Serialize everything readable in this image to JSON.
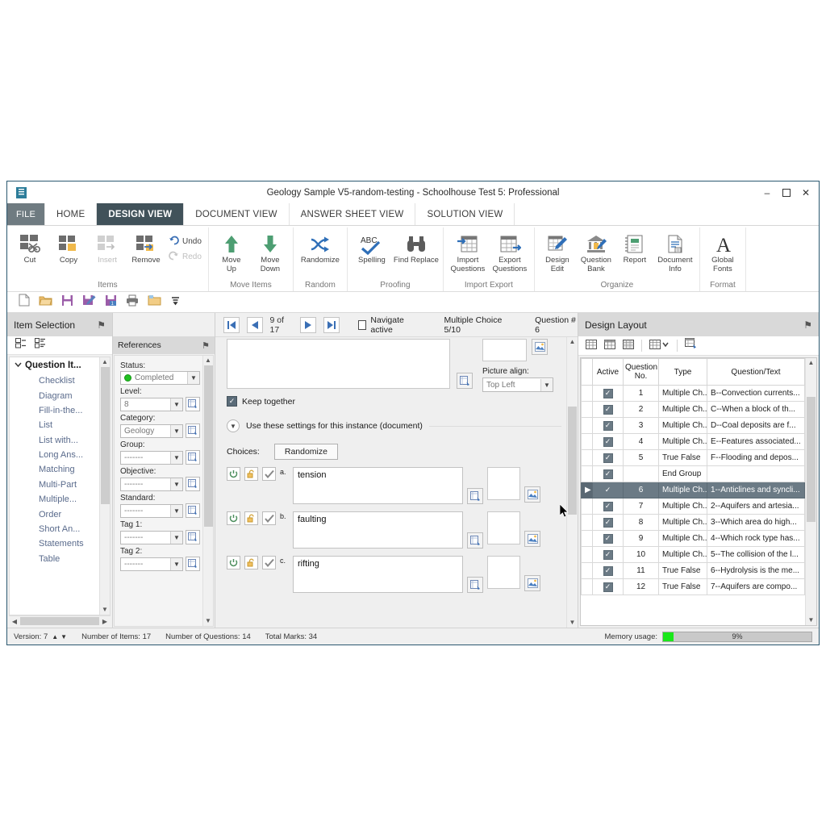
{
  "window": {
    "title": "Geology Sample V5-random-testing - Schoolhouse Test 5: Professional",
    "app_icon": "document-icon",
    "minimize": "–",
    "maximize": "❐",
    "close": "✕"
  },
  "ribbon_tabs": [
    {
      "label": "FILE",
      "style": "file"
    },
    {
      "label": "HOME",
      "style": ""
    },
    {
      "label": "DESIGN VIEW",
      "style": "active"
    },
    {
      "label": "DOCUMENT VIEW",
      "style": ""
    },
    {
      "label": "ANSWER SHEET VIEW",
      "style": ""
    },
    {
      "label": "SOLUTION VIEW",
      "style": ""
    }
  ],
  "ribbon": {
    "groups": [
      {
        "label": "Items",
        "buttons": [
          {
            "label": "Cut",
            "icon": "scissors-icon",
            "disabled": false
          },
          {
            "label": "Copy",
            "icon": "copy-icon",
            "disabled": false
          },
          {
            "label": "Insert",
            "icon": "insert-icon",
            "disabled": true
          },
          {
            "label": "Remove",
            "icon": "remove-icon",
            "disabled": false
          }
        ],
        "stack": [
          {
            "label": "Undo",
            "icon": "undo-icon",
            "disabled": false
          },
          {
            "label": "Redo",
            "icon": "redo-icon",
            "disabled": true
          }
        ]
      },
      {
        "label": "Move Items",
        "buttons": [
          {
            "label": "Move\nUp",
            "icon": "arrow-up-icon",
            "disabled": false
          },
          {
            "label": "Move\nDown",
            "icon": "arrow-down-icon",
            "disabled": false
          }
        ]
      },
      {
        "label": "Random",
        "buttons": [
          {
            "label": "Randomize",
            "icon": "shuffle-icon",
            "disabled": false
          }
        ]
      },
      {
        "label": "Proofing",
        "buttons": [
          {
            "label": "Spelling",
            "icon": "abc-check-icon",
            "disabled": false
          },
          {
            "label": "Find Replace",
            "icon": "binoculars-icon",
            "disabled": false
          }
        ]
      },
      {
        "label": "Import Export",
        "buttons": [
          {
            "label": "Import\nQuestions",
            "icon": "import-table-icon",
            "disabled": false
          },
          {
            "label": "Export\nQuestions",
            "icon": "export-table-icon",
            "disabled": false
          }
        ]
      },
      {
        "label": "Organize",
        "buttons": [
          {
            "label": "Design\nEdit",
            "icon": "table-pencil-icon",
            "disabled": false
          },
          {
            "label": "Question\nBank",
            "icon": "bank-icon",
            "disabled": false
          },
          {
            "label": "Report",
            "icon": "notebook-icon",
            "disabled": false
          },
          {
            "label": "Document\nInfo",
            "icon": "document-info-icon",
            "disabled": false
          }
        ]
      },
      {
        "label": "Format",
        "buttons": [
          {
            "label": "Global\nFonts",
            "icon": "font-a-icon",
            "disabled": false
          }
        ]
      }
    ]
  },
  "quick_access": [
    {
      "name": "new-file-icon"
    },
    {
      "name": "open-folder-icon"
    },
    {
      "name": "save-icon"
    },
    {
      "name": "save-edit-icon"
    },
    {
      "name": "save-as-icon"
    },
    {
      "name": "print-icon"
    },
    {
      "name": "folder-icon"
    },
    {
      "name": "more-dropdown-icon"
    }
  ],
  "item_selection": {
    "title": "Item Selection",
    "pin": "⚑",
    "toolbar": [
      {
        "name": "list-view-icon"
      },
      {
        "name": "detail-view-icon"
      }
    ],
    "root_label": "Question It...",
    "items": [
      {
        "label": "Checklist"
      },
      {
        "label": "Diagram"
      },
      {
        "label": "Fill-in-the..."
      },
      {
        "label": "List"
      },
      {
        "label": "List with..."
      },
      {
        "label": "Long Ans..."
      },
      {
        "label": "Matching"
      },
      {
        "label": "Multi-Part"
      },
      {
        "label": "Multiple..."
      },
      {
        "label": "Order"
      },
      {
        "label": "Short An..."
      },
      {
        "label": "Statements"
      },
      {
        "label": "Table"
      }
    ]
  },
  "references": {
    "title": "References",
    "pin": "⚑",
    "fields": [
      {
        "label": "Status:",
        "value": "Completed",
        "has_dot": true,
        "has_edit": false
      },
      {
        "label": "Level:",
        "value": "8",
        "has_dot": false,
        "has_edit": true
      },
      {
        "label": "Category:",
        "value": "Geology",
        "has_dot": false,
        "has_edit": true
      },
      {
        "label": "Group:",
        "value": "-------",
        "has_dot": false,
        "has_edit": true
      },
      {
        "label": "Objective:",
        "value": "-------",
        "has_dot": false,
        "has_edit": true
      },
      {
        "label": "Standard:",
        "value": "-------",
        "has_dot": false,
        "has_edit": true
      },
      {
        "label": "Tag 1:",
        "value": "-------",
        "has_dot": false,
        "has_edit": true
      },
      {
        "label": "Tag 2:",
        "value": "-------",
        "has_dot": false,
        "has_edit": true
      }
    ]
  },
  "navbar": {
    "first_icon": "first-record-icon",
    "prev_icon": "prev-record-icon",
    "next_icon": "next-record-icon",
    "last_icon": "last-record-icon",
    "position": "9 of 17",
    "navigate_active_label": "Navigate active",
    "type_info": "Multiple Choice  5/10",
    "question_info": "Question # 6"
  },
  "editor": {
    "question_text": "",
    "picture_align_label": "Picture align:",
    "picture_align_value": "Top Left",
    "keep_together_label": "Keep together",
    "instance_settings_label": "Use these settings for this instance (document)",
    "choices_label": "Choices:",
    "randomize_label": "Randomize",
    "choices": [
      {
        "letter": "a.",
        "text": "tension"
      },
      {
        "letter": "b.",
        "text": "faulting"
      },
      {
        "letter": "c.",
        "text": "rifting"
      }
    ]
  },
  "design_layout": {
    "title": "Design Layout",
    "pin": "⚑",
    "toolbar": [
      {
        "name": "grid-view-1-icon"
      },
      {
        "name": "grid-view-2-icon"
      },
      {
        "name": "grid-view-3-icon"
      },
      {
        "name": "grid-dropdown-icon"
      },
      {
        "name": "grid-edit-icon"
      }
    ],
    "columns": [
      "Active",
      "Question No.",
      "Type",
      "Question/Text"
    ],
    "rows": [
      {
        "active": true,
        "no": "1",
        "type": "Multiple Ch...",
        "text": "B--Convection  currents...",
        "selected": false
      },
      {
        "active": true,
        "no": "2",
        "type": "Multiple Ch...",
        "text": "C--When a block of th...",
        "selected": false
      },
      {
        "active": true,
        "no": "3",
        "type": "Multiple Ch...",
        "text": "D--Coal deposits are f...",
        "selected": false
      },
      {
        "active": true,
        "no": "4",
        "type": "Multiple Ch...",
        "text": "E--Features associated...",
        "selected": false
      },
      {
        "active": true,
        "no": "5",
        "type": "True False",
        "text": "F--Flooding and depos...",
        "selected": false
      },
      {
        "active": true,
        "no": "",
        "type": "End Group",
        "text": "",
        "selected": false
      },
      {
        "active": true,
        "no": "6",
        "type": "Multiple Ch...",
        "text": "1--Anticlines and syncli...",
        "selected": true
      },
      {
        "active": true,
        "no": "7",
        "type": "Multiple Ch...",
        "text": "2--Aquifers and artesia...",
        "selected": false
      },
      {
        "active": true,
        "no": "8",
        "type": "Multiple Ch...",
        "text": "3--Which area do high...",
        "selected": false
      },
      {
        "active": true,
        "no": "9",
        "type": "Multiple Ch...",
        "text": "4--Which rock type has...",
        "selected": false
      },
      {
        "active": true,
        "no": "10",
        "type": "Multiple Ch...",
        "text": "5--The collision of the l...",
        "selected": false
      },
      {
        "active": true,
        "no": "11",
        "type": "True False",
        "text": "6--Hydrolysis is the me...",
        "selected": false
      },
      {
        "active": true,
        "no": "12",
        "type": "True False",
        "text": "7--Aquifers are compo...",
        "selected": false
      }
    ]
  },
  "statusbar": {
    "version": "Version: 7",
    "up_arrow": "▲",
    "down_arrow": "▼",
    "num_items": "Number of Items: 17",
    "num_questions": "Number of Questions: 14",
    "total_marks": "Total Marks: 34",
    "memory_label": "Memory usage:",
    "memory_percent": "9%",
    "memory_fill_color": "#1ae81a"
  }
}
